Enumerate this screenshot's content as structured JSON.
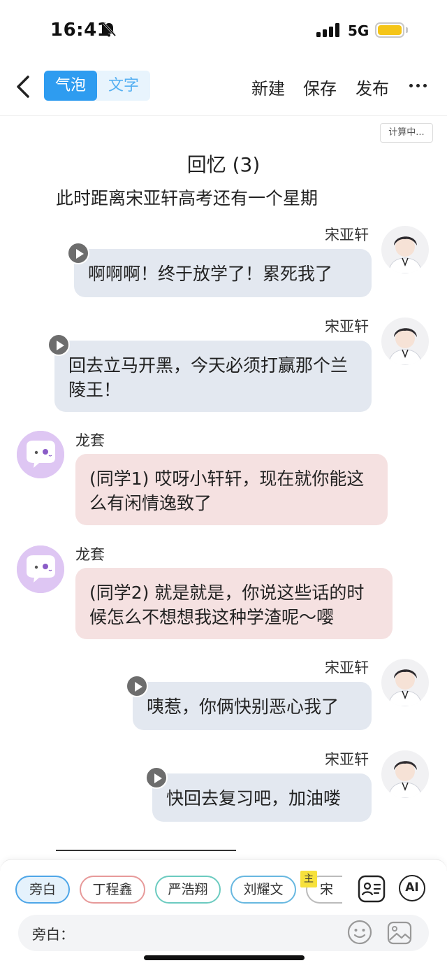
{
  "status_bar": {
    "time": "16:41",
    "network": "5G",
    "battery_color": "#f5c518"
  },
  "nav": {
    "modes": [
      "气泡",
      "文字"
    ],
    "active_mode": "气泡",
    "actions": [
      "新建",
      "保存",
      "发布"
    ],
    "accent_color": "#2e9cf0"
  },
  "calc_badge": "计算中...",
  "story": {
    "title": "回忆 (3)",
    "narration": "此时距离宋亚轩高考还有一个星期"
  },
  "messages": [
    {
      "sender": "宋亚轩",
      "side": "right",
      "text": "啊啊啊！终于放学了！累死我了",
      "has_voice": true
    },
    {
      "sender": "宋亚轩",
      "side": "right",
      "text": "回去立马开黑，今天必须打赢那个兰陵王！",
      "has_voice": true
    },
    {
      "sender": "龙套",
      "side": "left",
      "text": "(同学1) 哎呀小轩轩，现在就你能这么有闲情逸致了",
      "has_voice": false
    },
    {
      "sender": "龙套",
      "side": "left",
      "text": "(同学2) 就是就是，你说这些话的时候怎么不想想我这种学渣呢～嘤",
      "has_voice": false
    },
    {
      "sender": "宋亚轩",
      "side": "right",
      "text": "咦惹，你俩快别恶心我了",
      "has_voice": true
    },
    {
      "sender": "宋亚轩",
      "side": "right",
      "text": "快回去复习吧，加油喽",
      "has_voice": true
    }
  ],
  "characters": [
    {
      "name": "旁白",
      "selected": true
    },
    {
      "name": "丁程鑫",
      "selected": false
    },
    {
      "name": "严浩翔",
      "selected": false
    },
    {
      "name": "刘耀文",
      "selected": false
    },
    {
      "name": "宋亚",
      "selected": false,
      "main_tag": "主"
    }
  ],
  "ai_label": "AI",
  "input": {
    "prefix": "旁白：",
    "value": ""
  }
}
